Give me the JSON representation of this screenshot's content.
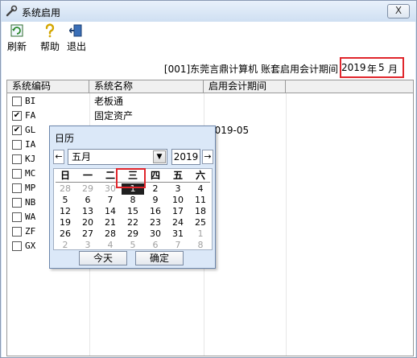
{
  "window": {
    "title": "系统启用",
    "close_label": "X"
  },
  "toolbar": {
    "refresh_label": "刷新",
    "help_label": "帮助",
    "exit_label": "退出"
  },
  "period": {
    "company_text": "[001]东莞言鼎计算机 账套启用会计期间",
    "year": "2019",
    "nian": "年",
    "month": "5",
    "yue": "月"
  },
  "grid": {
    "headers": [
      "系统编码",
      "系统名称",
      "启用会计期间"
    ],
    "rows": [
      {
        "code": "BI",
        "name": "老板通",
        "date": "",
        "checked": false
      },
      {
        "code": "FA",
        "name": "固定资产",
        "date": "",
        "checked": true
      },
      {
        "code": "GL",
        "name": "",
        "date": "2019-05",
        "checked": true
      },
      {
        "code": "IA",
        "name": "",
        "date": "",
        "checked": false
      },
      {
        "code": "KJ",
        "name": "",
        "date": "",
        "checked": false
      },
      {
        "code": "MC",
        "name": "",
        "date": "",
        "checked": false
      },
      {
        "code": "MP",
        "name": "",
        "date": "",
        "checked": false
      },
      {
        "code": "NB",
        "name": "",
        "date": "",
        "checked": false
      },
      {
        "code": "WA",
        "name": "",
        "date": "",
        "checked": false
      },
      {
        "code": "ZF",
        "name": "",
        "date": "",
        "checked": false
      },
      {
        "code": "GX",
        "name": "",
        "date": "",
        "checked": false
      }
    ]
  },
  "calendar": {
    "title": "日历",
    "prev_label": "←",
    "next_label": "→",
    "month_value": "五月",
    "year_value": "2019",
    "weekdays": [
      "日",
      "一",
      "二",
      "三",
      "四",
      "五",
      "六"
    ],
    "weeks": [
      [
        {
          "d": "28",
          "m": true
        },
        {
          "d": "29",
          "m": true
        },
        {
          "d": "30",
          "m": true
        },
        {
          "d": "1",
          "sel": true
        },
        {
          "d": "2"
        },
        {
          "d": "3"
        },
        {
          "d": "4"
        }
      ],
      [
        {
          "d": "5"
        },
        {
          "d": "6"
        },
        {
          "d": "7"
        },
        {
          "d": "8"
        },
        {
          "d": "9"
        },
        {
          "d": "10"
        },
        {
          "d": "11"
        }
      ],
      [
        {
          "d": "12"
        },
        {
          "d": "13"
        },
        {
          "d": "14"
        },
        {
          "d": "15"
        },
        {
          "d": "16"
        },
        {
          "d": "17"
        },
        {
          "d": "18"
        }
      ],
      [
        {
          "d": "19"
        },
        {
          "d": "20"
        },
        {
          "d": "21"
        },
        {
          "d": "22"
        },
        {
          "d": "23"
        },
        {
          "d": "24"
        },
        {
          "d": "25"
        }
      ],
      [
        {
          "d": "26"
        },
        {
          "d": "27"
        },
        {
          "d": "28"
        },
        {
          "d": "29"
        },
        {
          "d": "30"
        },
        {
          "d": "31"
        },
        {
          "d": "1",
          "m": true
        }
      ],
      [
        {
          "d": "2",
          "m": true
        },
        {
          "d": "3",
          "m": true
        },
        {
          "d": "4",
          "m": true
        },
        {
          "d": "5",
          "m": true
        },
        {
          "d": "6",
          "m": true
        },
        {
          "d": "7",
          "m": true
        },
        {
          "d": "8",
          "m": true
        }
      ]
    ],
    "today_label": "今天",
    "ok_label": "确定"
  },
  "colors": {
    "highlight": "#e0262c",
    "selected_day": "#202020"
  }
}
